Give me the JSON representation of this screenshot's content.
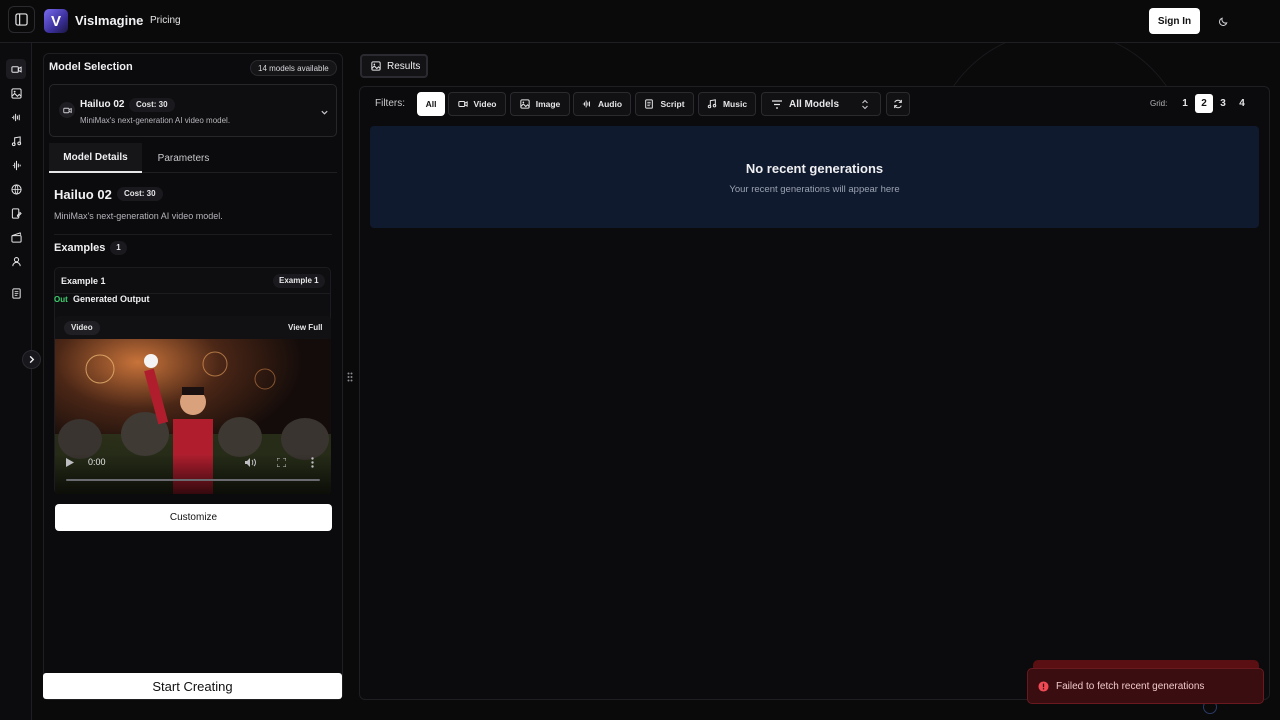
{
  "header": {
    "brand": "VisImagine",
    "logo_letter": "V",
    "nav_pricing": "Pricing",
    "sign_in": "Sign In",
    "icons": [
      "sidebar-toggle-icon",
      "moon-icon"
    ]
  },
  "rail": {
    "items": [
      "video-icon",
      "image-icon",
      "audio-wave-icon",
      "music-icon",
      "voice-icon",
      "globe-icon",
      "script-edit-icon",
      "clapperboard-icon",
      "user-icon",
      "document-icon"
    ],
    "expand_icon": "chevron-right-icon"
  },
  "model_panel": {
    "title": "Model Selection",
    "models_available": "14 models available",
    "selected": {
      "name": "Hailuo 02",
      "cost": "Cost: 30",
      "description": "MiniMax's next-generation AI video model."
    },
    "tabs": [
      {
        "label": "Model Details",
        "active": true
      },
      {
        "label": "Parameters",
        "active": false
      }
    ],
    "details": {
      "name": "Hailuo 02",
      "cost": "Cost: 30",
      "description": "MiniMax's next-generation AI video model."
    },
    "examples": {
      "title": "Examples",
      "count": "1",
      "items": [
        {
          "label": "Example 1",
          "tag": "Example 1",
          "out_tag": "Out",
          "out_label": "Generated Output",
          "media_badge": "Video",
          "view_full": "View Full",
          "time": "0:00"
        }
      ]
    },
    "customize": "Customize",
    "start_creating": "Start Creating"
  },
  "results": {
    "tab_label": "Results",
    "filters_label": "Filters:",
    "filters": [
      {
        "label": "All",
        "icon": "",
        "active": true
      },
      {
        "label": "Video",
        "icon": "video-icon",
        "active": false
      },
      {
        "label": "Image",
        "icon": "image-icon",
        "active": false
      },
      {
        "label": "Audio",
        "icon": "audio-wave-icon",
        "active": false
      },
      {
        "label": "Script",
        "icon": "document-icon",
        "active": false
      },
      {
        "label": "Music",
        "icon": "music-icon",
        "active": false
      }
    ],
    "models_select": "All Models",
    "grid_label": "Grid:",
    "grid_options": [
      "1",
      "2",
      "3",
      "4"
    ],
    "grid_selected": "2",
    "empty_title": "No recent generations",
    "empty_subtitle": "Your recent generations will appear here"
  },
  "toast": {
    "message": "Failed to fetch recent generations",
    "color": "#3a0d10"
  },
  "colors": {
    "background": "#0a0a0b",
    "accent_green": "#3ecf6e",
    "empty_panel": "#0f1a2e"
  }
}
